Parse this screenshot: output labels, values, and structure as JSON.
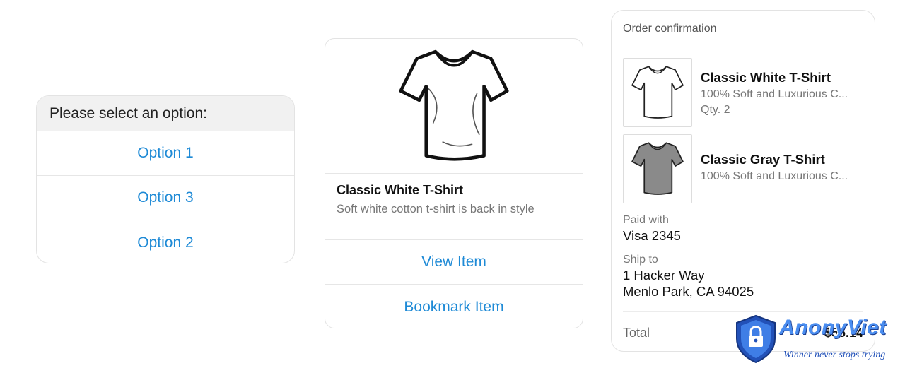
{
  "quick_replies": {
    "prompt": "Please select an option:",
    "options": [
      "Option 1",
      "Option 3",
      "Option 2"
    ]
  },
  "product_card": {
    "image_icon": "white-tshirt-icon",
    "title": "Classic White T-Shirt",
    "subtitle": "Soft white cotton t-shirt is back in style",
    "buttons": [
      "View Item",
      "Bookmark Item"
    ]
  },
  "receipt": {
    "header": "Order confirmation",
    "items": [
      {
        "name": "Classic White T-Shirt",
        "description": "100% Soft and Luxurious C...",
        "quantity": "Qty. 2",
        "image_icon": "white-tshirt-icon"
      },
      {
        "name": "Classic Gray T-Shirt",
        "description": "100% Soft and Luxurious C...",
        "image_icon": "gray-tshirt-icon"
      }
    ],
    "paid_with_label": "Paid with",
    "paid_with_value": "Visa 2345",
    "ship_to_label": "Ship to",
    "ship_to_line1": "1 Hacker Way",
    "ship_to_line2": "Menlo Park, CA 94025",
    "total_label": "Total",
    "total_value": "$56.14"
  },
  "watermark": {
    "brand": "AnonyViet",
    "tagline": "Winner never stops trying",
    "icon": "shield-lock-icon"
  },
  "colors": {
    "accent": "#1e8ad6",
    "gray_shirt": "#8a8a8a",
    "watermark_blue": "#2251b8"
  }
}
